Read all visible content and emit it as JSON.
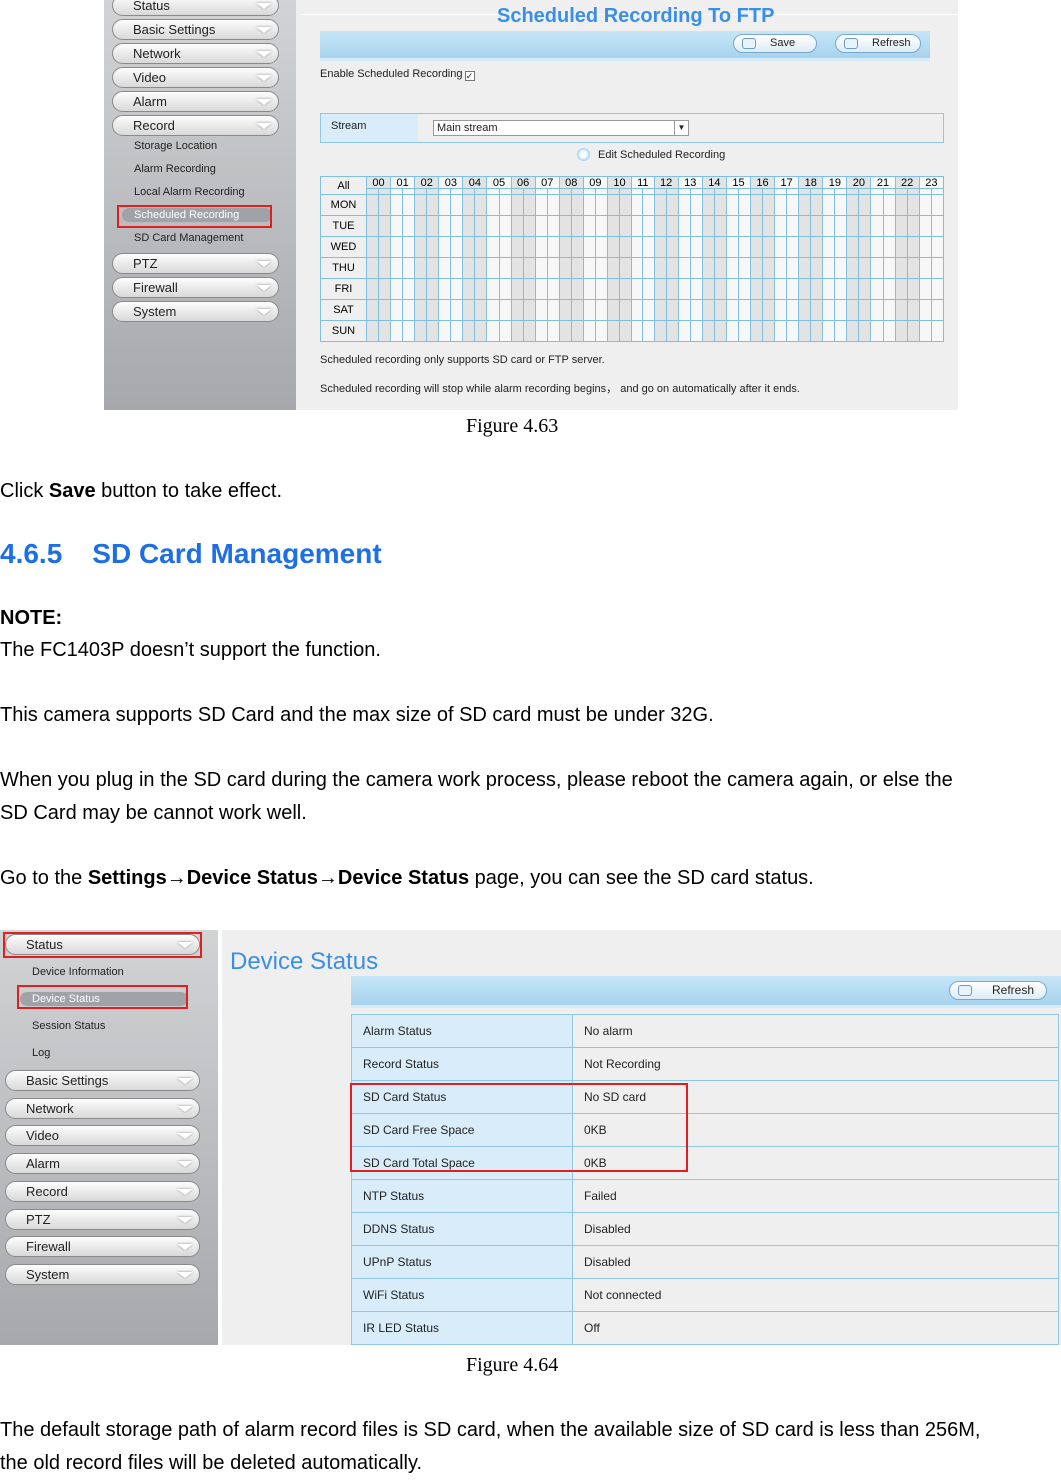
{
  "figure1": {
    "sidebar": {
      "menu": [
        "Status",
        "Basic Settings",
        "Network",
        "Video",
        "Alarm",
        "Record"
      ],
      "record_sub": [
        "Storage Location",
        "Alarm Recording",
        "Local Alarm Recording",
        "Scheduled Recording",
        "SD Card Management"
      ],
      "menu2": [
        "PTZ",
        "Firewall",
        "System"
      ]
    },
    "title": "Scheduled Recording To FTP",
    "save": "Save",
    "refresh": "Refresh",
    "enable_label": "Enable Scheduled Recording",
    "enable_checked": true,
    "stream_label": "Stream",
    "stream_value": "Main stream",
    "edit_label": "Edit Scheduled Recording",
    "all_label": "All",
    "hours": [
      "00",
      "01",
      "02",
      "03",
      "04",
      "05",
      "06",
      "07",
      "08",
      "09",
      "10",
      "11",
      "12",
      "13",
      "14",
      "15",
      "16",
      "17",
      "18",
      "19",
      "20",
      "21",
      "22",
      "23"
    ],
    "days": [
      "MON",
      "TUE",
      "WED",
      "THU",
      "FRI",
      "SAT",
      "SUN"
    ],
    "note1": "Scheduled recording only supports SD card or FTP server.",
    "note2": "Scheduled recording will stop while alarm recording begins，  and go on automatically after it ends.",
    "caption": "Figure 4.63"
  },
  "doc": {
    "p1_pre": "Click ",
    "p1_bold": "Save",
    "p1_post": " button to take effect.",
    "heading_num": "4.6.5",
    "heading": "SD Card Management",
    "note": "NOTE:",
    "p2": "The FC1403P doesn’t support the function.",
    "p3": "This camera supports SD Card and the max size of SD card must be under 32G.",
    "p4a": "When you plug in the SD card during the camera work process, please reboot the camera again, or else the",
    "p4b": "SD Card may be cannot work well.",
    "p5_pre": "Go to the ",
    "p5_bold": "Settings→Device Status→Device Status",
    "p5_post": " page, you can see the SD card status.",
    "p6a": "The default storage path of alarm record files is SD card, when the available size of SD card is less than 256M,",
    "p6b": "the old record files will be deleted automatically."
  },
  "figure2": {
    "sidebar": {
      "status": "Status",
      "status_sub": [
        "Device Information",
        "Device Status",
        "Session Status",
        "Log"
      ],
      "menu": [
        "Basic Settings",
        "Network",
        "Video",
        "Alarm",
        "Record",
        "PTZ",
        "Firewall",
        "System"
      ]
    },
    "title": "Device Status",
    "refresh": "Refresh",
    "rows": [
      [
        "Alarm Status",
        "No alarm"
      ],
      [
        "Record Status",
        "Not Recording"
      ],
      [
        "SD Card Status",
        "No SD card"
      ],
      [
        "SD Card Free Space",
        "0KB"
      ],
      [
        "SD Card Total Space",
        "0KB"
      ],
      [
        "NTP Status",
        "Failed"
      ],
      [
        "DDNS Status",
        "Disabled"
      ],
      [
        "UPnP Status",
        "Disabled"
      ],
      [
        "WiFi Status",
        "Not connected"
      ],
      [
        "IR LED Status",
        "Off"
      ]
    ],
    "caption": "Figure 4.64"
  }
}
